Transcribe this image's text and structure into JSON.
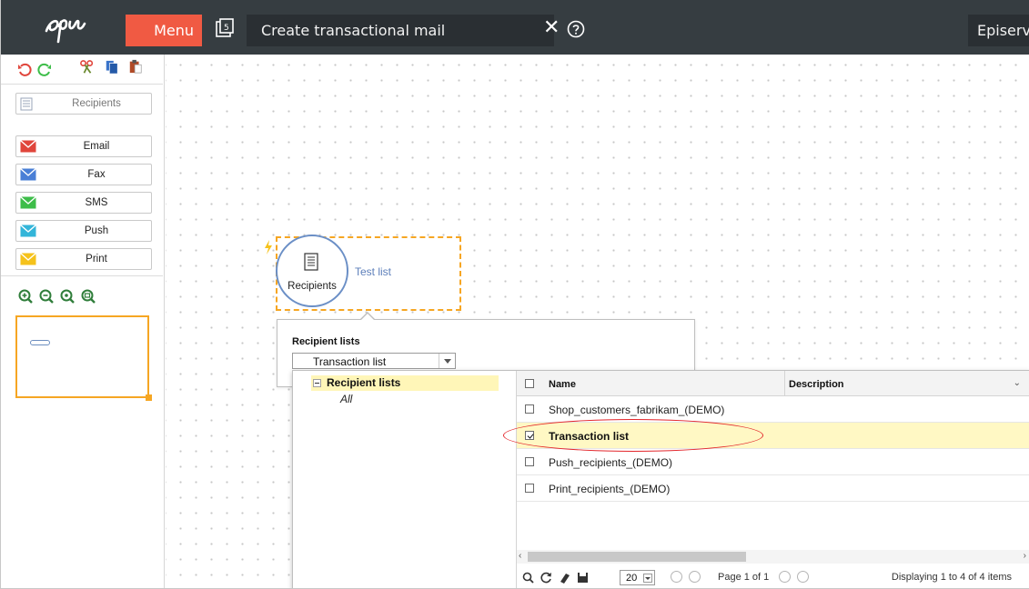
{
  "header": {
    "logo_text": "epi",
    "menu_label": "Menu",
    "title": "Create transactional mail",
    "user_label": "Episerver"
  },
  "sidebar": {
    "recipients_label": "Recipients",
    "channels": [
      {
        "label": "Email",
        "color": "#e0453b"
      },
      {
        "label": "Fax",
        "color": "#4a7fd6"
      },
      {
        "label": "SMS",
        "color": "#3dbd49"
      },
      {
        "label": "Push",
        "color": "#33b5d9"
      },
      {
        "label": "Print",
        "color": "#f5c21b"
      }
    ]
  },
  "canvas": {
    "node_label": "Recipients",
    "node_link": "Test list"
  },
  "popup": {
    "heading": "Recipient lists",
    "selected": "Transaction list"
  },
  "tree": {
    "root": "Recipient lists",
    "child": "All"
  },
  "grid": {
    "col_name": "Name",
    "col_description": "Description",
    "rows": [
      {
        "name": "Shop_customers_fabrikam_(DEMO)",
        "checked": false
      },
      {
        "name": "Transaction list",
        "checked": true
      },
      {
        "name": "Push_recipients_(DEMO)",
        "checked": false
      },
      {
        "name": "Print_recipients_(DEMO)",
        "checked": false
      }
    ],
    "page_size": "20",
    "page_text": "Page 1 of 1",
    "display_text": "Displaying 1 to 4 of 4 items"
  },
  "colors": {
    "topbar": "#363d41",
    "menu": "#f05a43",
    "accent_orange": "#f6a623",
    "selection": "#fff8c4",
    "highlight_ring": "#e3262b"
  }
}
